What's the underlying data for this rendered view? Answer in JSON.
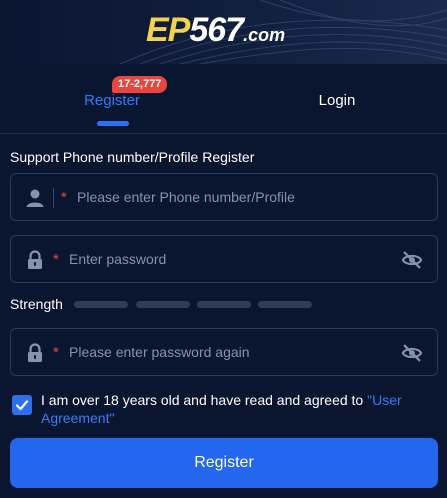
{
  "header": {
    "logo": {
      "ep": "EP",
      "num": "567",
      "dom": ".com"
    }
  },
  "tabs": {
    "register_label": "Register",
    "login_label": "Login",
    "badge": "17-2,777"
  },
  "form": {
    "section_label": "Support Phone number/Profile Register",
    "required_mark": "*",
    "phone": {
      "placeholder": "Please enter Phone number/Profile",
      "value": ""
    },
    "password": {
      "placeholder": "Enter password",
      "value": ""
    },
    "password_confirm": {
      "placeholder": "Please enter password again",
      "value": ""
    },
    "strength_label": "Strength",
    "strength_level": 0,
    "agreement": {
      "checked": true,
      "text": "I am over 18 years old and have read and agreed to ",
      "link_text": "\"User Agreement\""
    },
    "submit_label": "Register"
  },
  "colors": {
    "background": "#0a1530",
    "accent": "#2466ee",
    "active_tab": "#2f7cf6",
    "badge": "#e8463e",
    "required": "#e24a4a",
    "logo_gold": "#f3d34a"
  },
  "icons": {
    "user": "user-icon",
    "lock": "lock-icon",
    "eye_off": "eye-off-icon",
    "check": "check-icon"
  }
}
